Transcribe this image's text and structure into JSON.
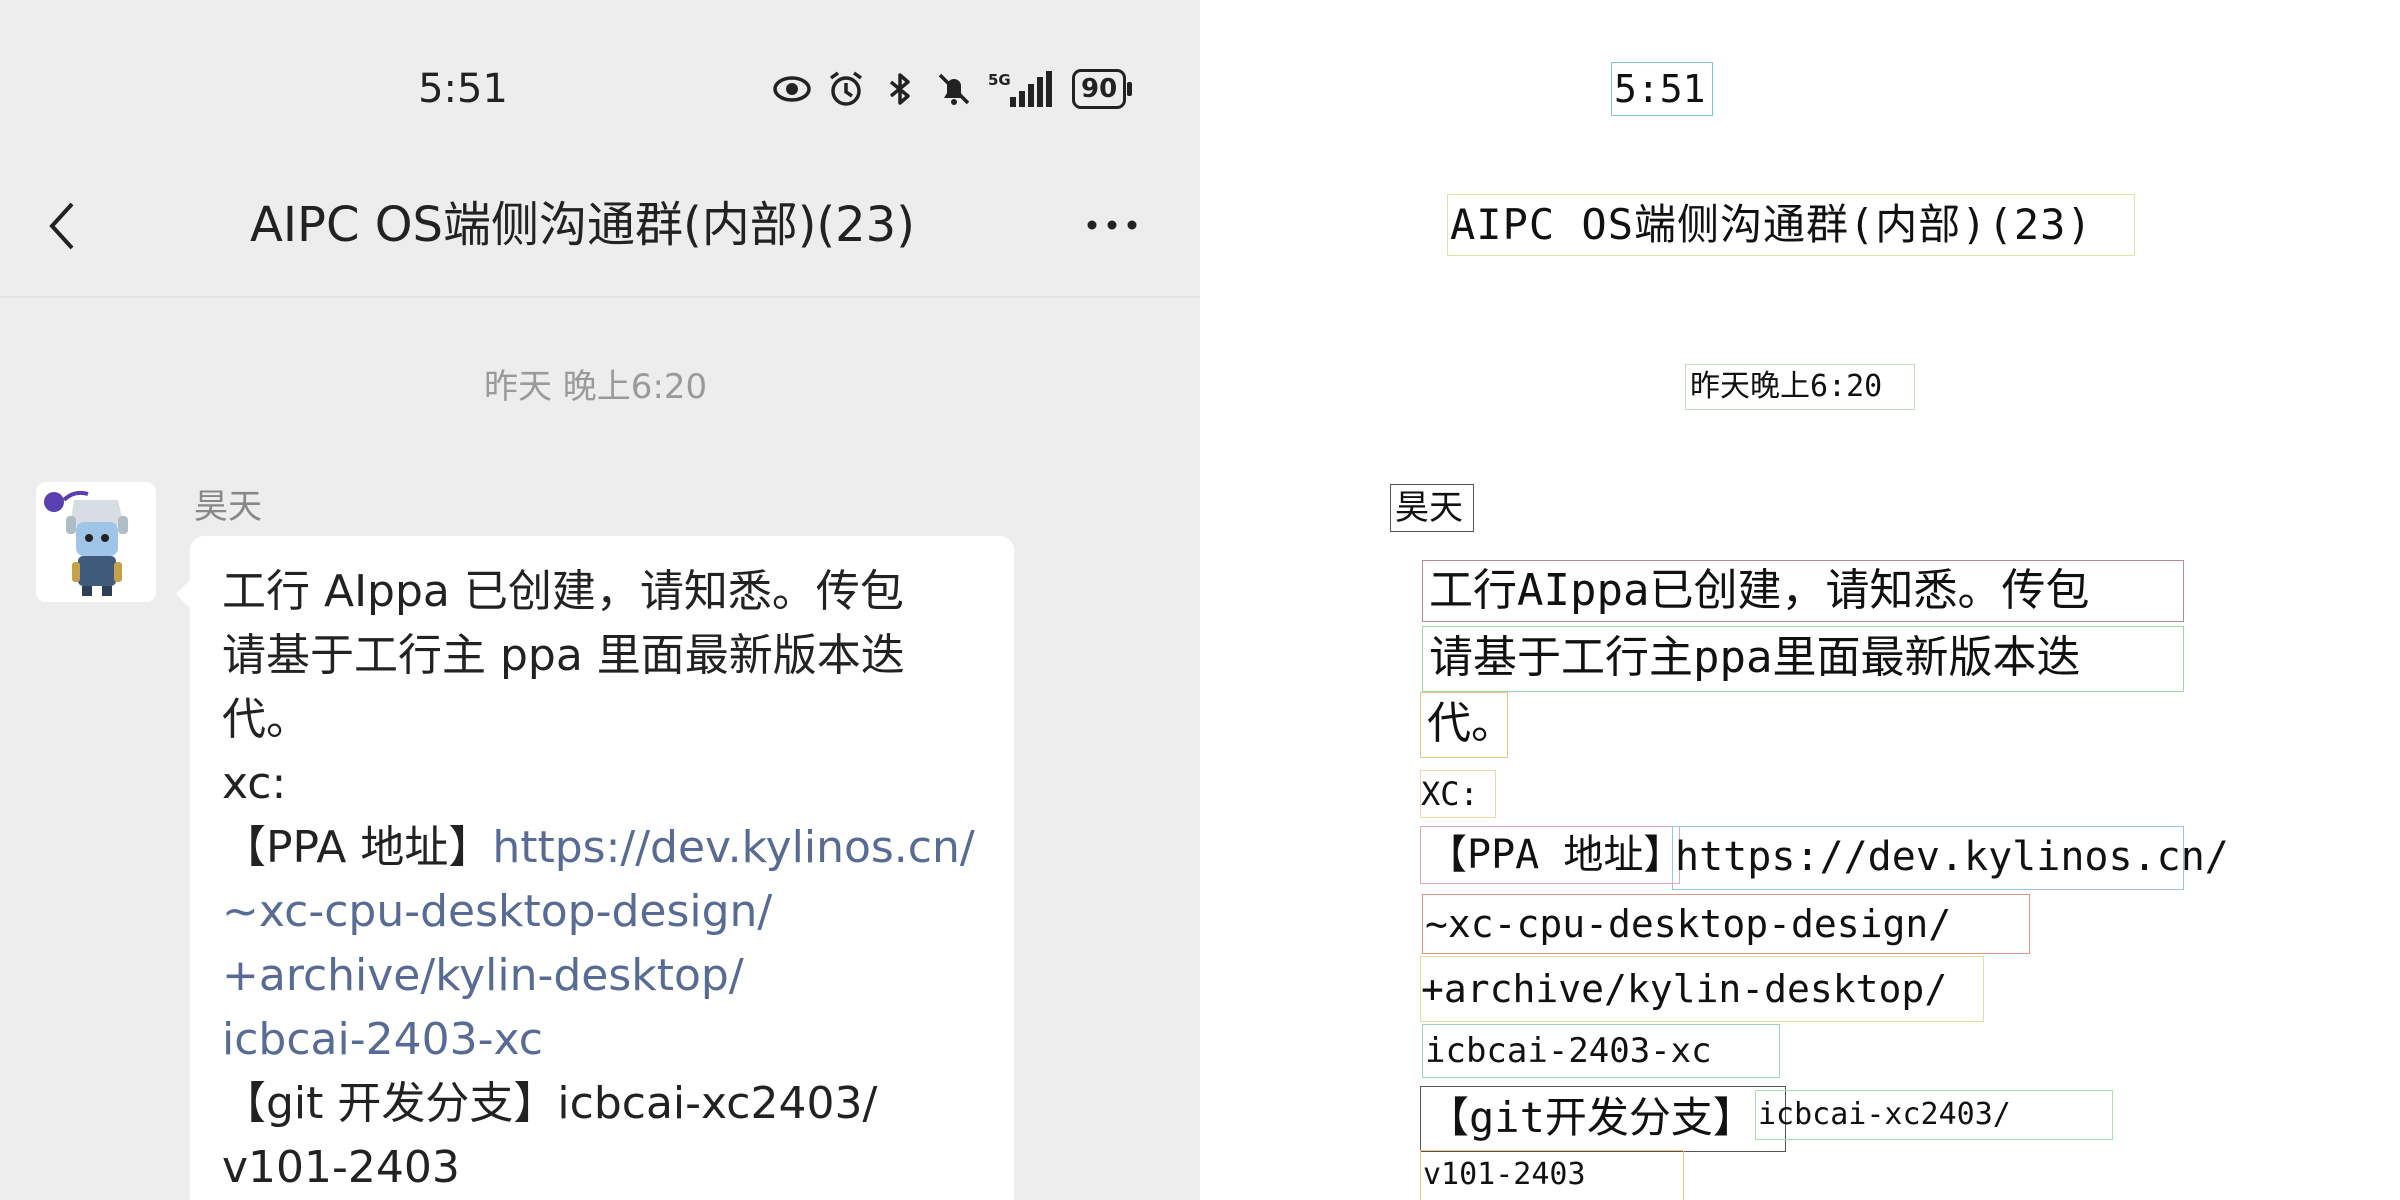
{
  "status_bar": {
    "time": "5:51",
    "icons": [
      "eye-icon",
      "alarm-icon",
      "bluetooth-icon",
      "bell-off-icon",
      "5g-signal-icon"
    ],
    "signal_label": "5G",
    "battery": "90"
  },
  "header": {
    "title": "AIPC OS端侧沟通群(内部)(23)"
  },
  "chat": {
    "timestamp": "昨天 晚上6:20",
    "sender": "昊天",
    "message_lines": [
      "工行 AIppa 已创建，请知悉。传包",
      "请基于工行主 ppa 里面最新版本迭",
      "代。",
      "xc:",
      "【PPA 地址】",
      "https://dev.kylinos.cn/",
      "~xc-cpu-desktop-design/",
      "+archive/kylin-desktop/",
      "icbcai-2403-xc",
      "【git 开发分支】",
      "icbcai-xc2403/",
      "v101-2403"
    ]
  },
  "outline": {
    "time": "5:51",
    "title": "AIPC OS端侧沟通群(内部)(23)",
    "timestamp": "昨天晚上6:20",
    "sender": "昊天",
    "lines": [
      "工行AIppa已创建，请知悉。传包",
      "请基于工行主ppa里面最新版本迭",
      "代。",
      "XC:",
      "【PPA 地址】",
      "https://dev.kylinos.cn/",
      "~xc-cpu-desktop-design/",
      "+archive/kylin-desktop/",
      "icbcai-2403-xc",
      "【git开发分支】",
      "icbcai-xc2403/",
      "v101-2403"
    ]
  },
  "colors": {
    "panel_bg": "#ededed",
    "bubble_bg": "#ffffff",
    "link": "#576b95"
  }
}
